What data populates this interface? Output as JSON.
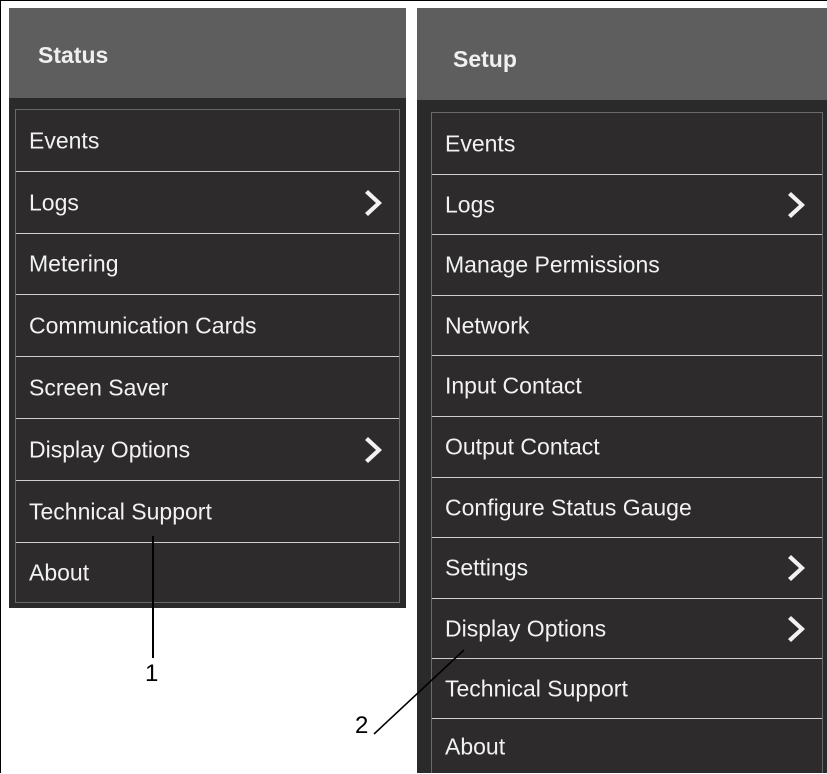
{
  "status_panel": {
    "title": "Status",
    "items": [
      {
        "label": "Events",
        "has_submenu": false
      },
      {
        "label": "Logs",
        "has_submenu": true
      },
      {
        "label": "Metering",
        "has_submenu": false
      },
      {
        "label": "Communication Cards",
        "has_submenu": false
      },
      {
        "label": "Screen Saver",
        "has_submenu": false
      },
      {
        "label": "Display Options",
        "has_submenu": true
      },
      {
        "label": "Technical Support",
        "has_submenu": false
      },
      {
        "label": "About",
        "has_submenu": false
      }
    ]
  },
  "setup_panel": {
    "title": "Setup",
    "items": [
      {
        "label": "Events",
        "has_submenu": false
      },
      {
        "label": "Logs",
        "has_submenu": true
      },
      {
        "label": "Manage Permissions",
        "has_submenu": false
      },
      {
        "label": "Network",
        "has_submenu": false
      },
      {
        "label": "Input Contact",
        "has_submenu": false
      },
      {
        "label": "Output Contact",
        "has_submenu": false
      },
      {
        "label": "Configure Status Gauge",
        "has_submenu": false
      },
      {
        "label": "Settings",
        "has_submenu": true
      },
      {
        "label": "Display Options",
        "has_submenu": true
      },
      {
        "label": "Technical Support",
        "has_submenu": false
      },
      {
        "label": "About",
        "has_submenu": false
      }
    ]
  },
  "callouts": [
    "1",
    "2"
  ],
  "colors": {
    "header_bg": "#5e5e5e",
    "menu_bg": "#2d2b2b",
    "text": "#f2f2f2",
    "divider": "#cfcfcf"
  }
}
